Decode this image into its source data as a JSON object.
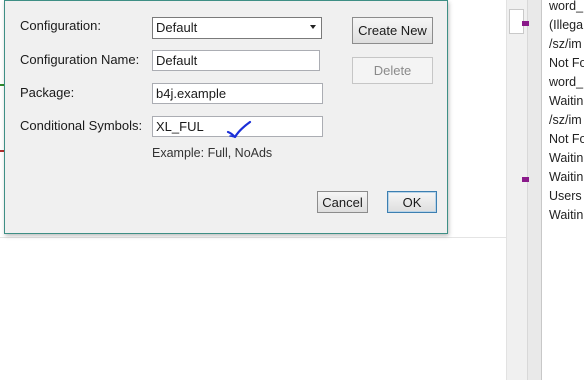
{
  "dialog": {
    "configuration_label": "Configuration:",
    "configuration_value": "Default",
    "configuration_name_label": "Configuration Name:",
    "configuration_name_value": "Default",
    "package_label": "Package:",
    "package_value": "b4j.example",
    "conditional_symbols_label": "Conditional Symbols:",
    "conditional_symbols_value": "XL_FUL",
    "example_text": "Example: Full, NoAds",
    "create_new_label": "Create New",
    "delete_label": "Delete",
    "cancel_label": "Cancel",
    "ok_label": "OK"
  },
  "log_panel": {
    "lines": [
      "word_",
      "(Illega",
      "/sz/im",
      "Not Fo",
      "word_",
      "Waitin",
      "/sz/im",
      "Not Fo",
      "Waitin",
      "Waitin",
      "Users",
      "Waitin"
    ]
  },
  "colors": {
    "dialog_border": "#3e8f85",
    "annotation_check": "#1a2fd8",
    "marker_purple": "#8a1a8a"
  },
  "icons": {
    "select_arrow": "chevron-down-icon",
    "annotation": "hand-drawn-checkmark-icon"
  }
}
